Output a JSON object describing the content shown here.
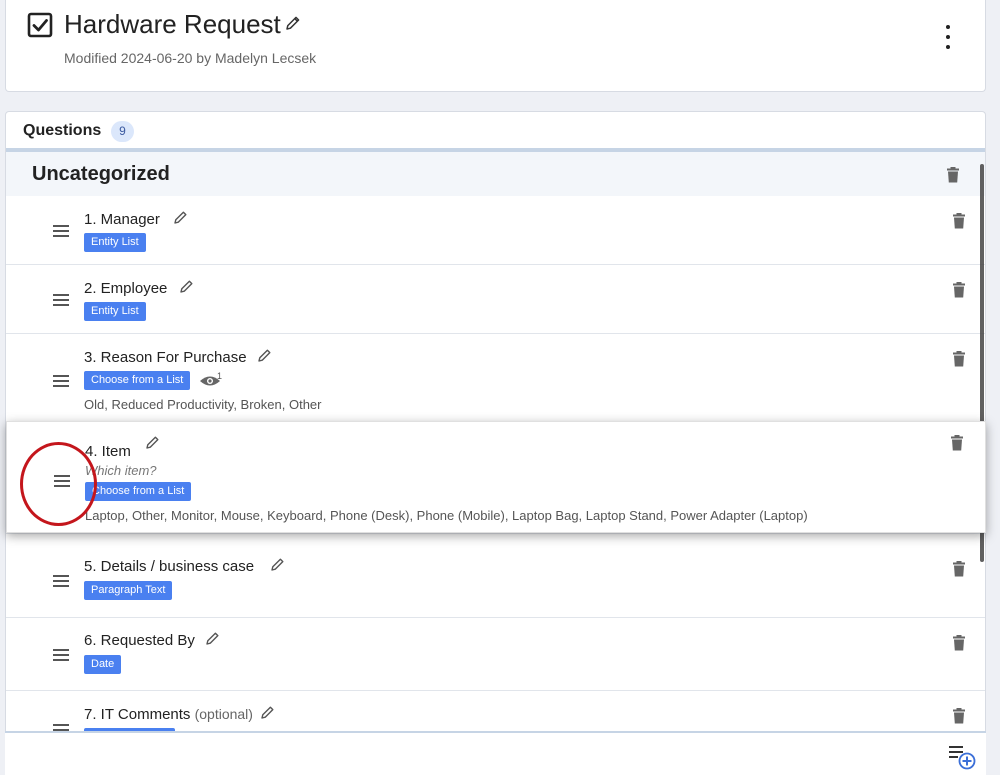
{
  "form": {
    "title": "Hardware Request",
    "modified": "Modified 2024-06-20 by Madelyn Lecsek"
  },
  "questions_panel": {
    "title": "Questions",
    "count": "9",
    "category": "Uncategorized"
  },
  "questions": [
    {
      "label": "1. Manager",
      "type": "Entity List"
    },
    {
      "label": "2. Employee",
      "type": "Entity List"
    },
    {
      "label": "3. Reason For Purchase",
      "type": "Choose from a List",
      "visibility_count": "1",
      "options": "Old, Reduced Productivity, Broken, Other"
    },
    {
      "label": "4. Item",
      "subtitle": "Which item?",
      "type": "Choose from a List",
      "options": "Laptop, Other, Monitor, Mouse, Keyboard, Phone (Desk), Phone (Mobile), Laptop Bag, Laptop Stand, Power Adapter (Laptop)"
    },
    {
      "label": "5. Details / business case",
      "type": "Paragraph Text"
    },
    {
      "label": "6. Requested By",
      "type": "Date"
    },
    {
      "label": "7. IT Comments",
      "optional": "(optional)"
    }
  ],
  "colors": {
    "badge": "#4a80f0",
    "highlight_circle": "#c4161c"
  }
}
